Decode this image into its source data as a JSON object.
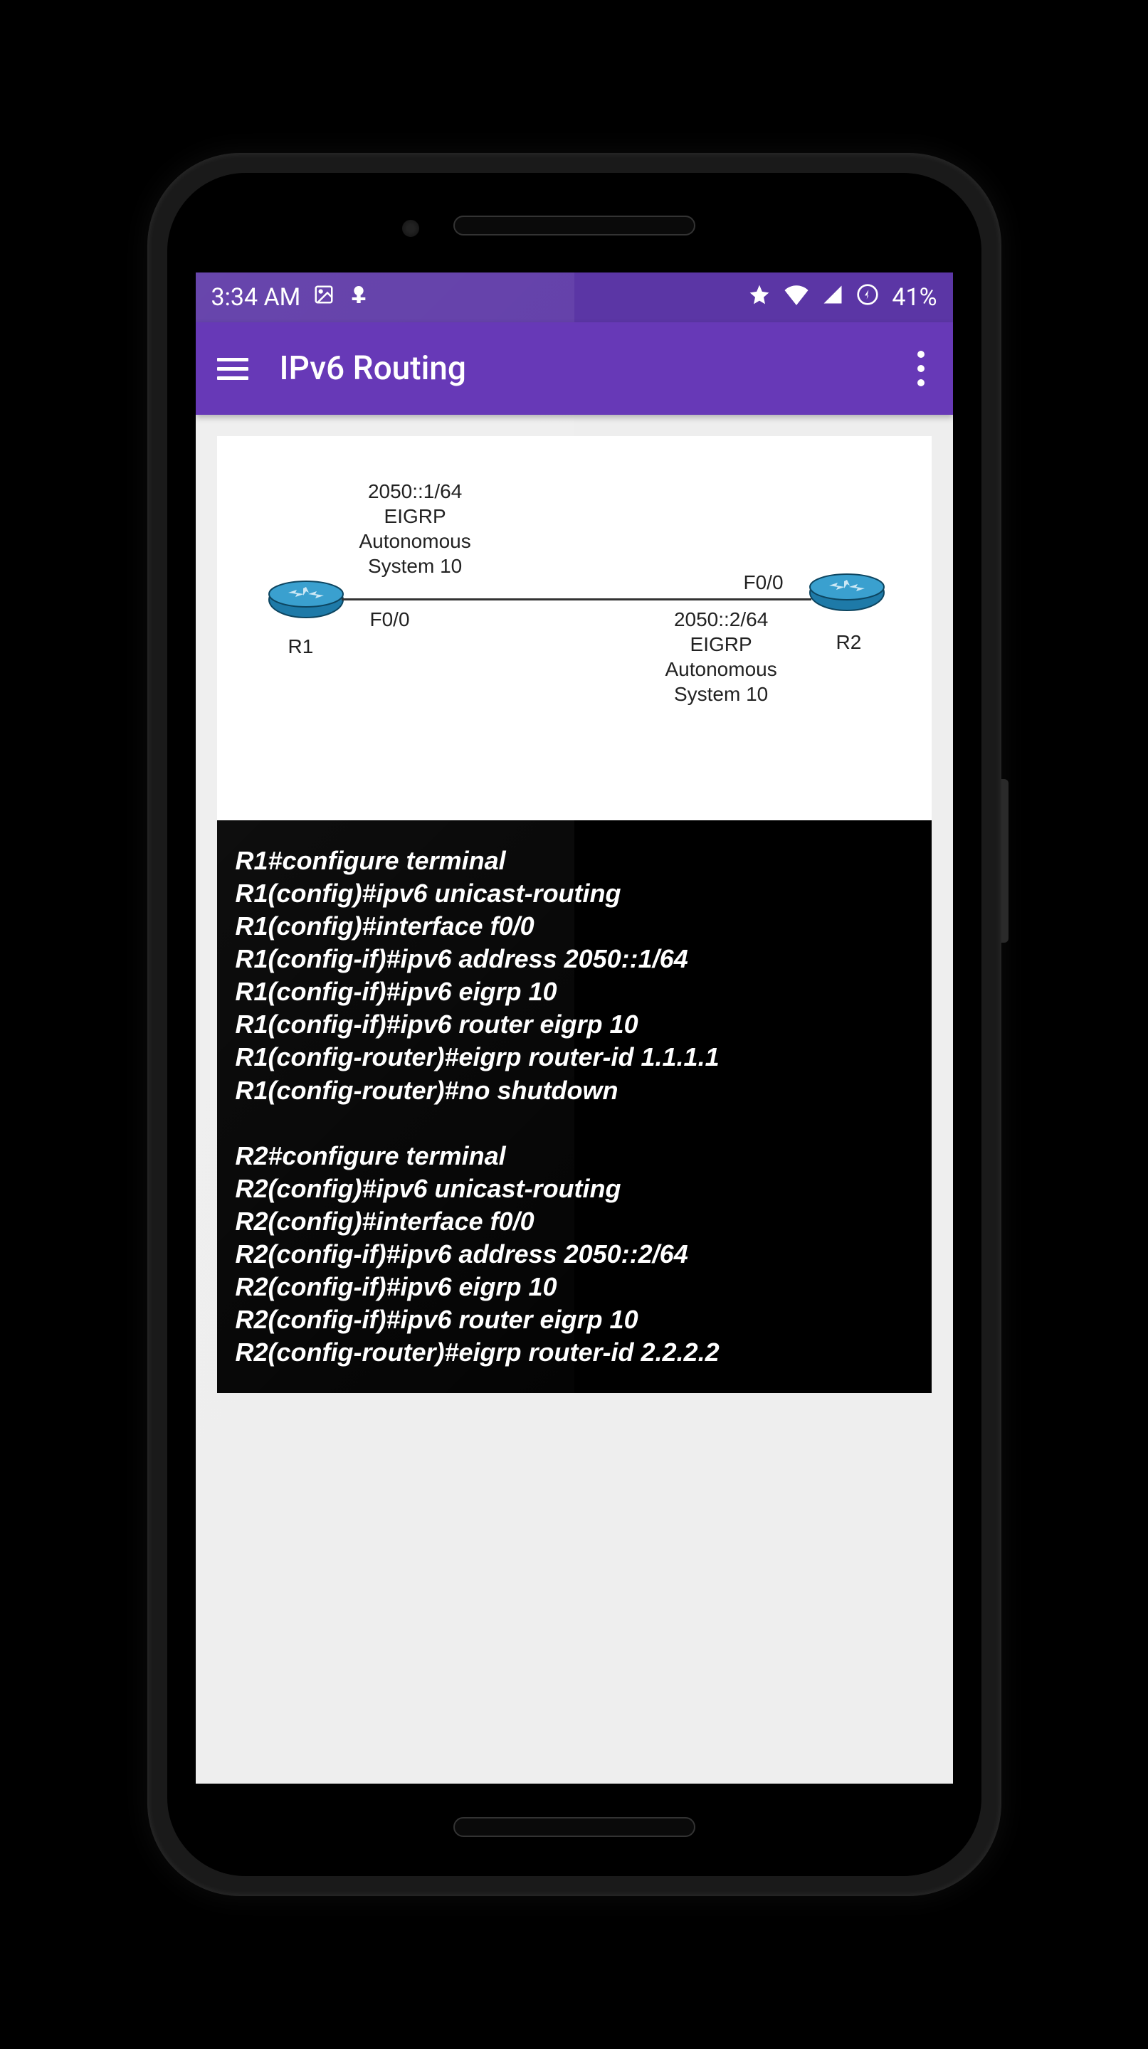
{
  "status_bar": {
    "time": "3:34 AM",
    "battery_percent": "41%",
    "icons_left": [
      "image-icon",
      "android-icon"
    ],
    "icons_right": [
      "star-icon",
      "wifi-icon",
      "cell-icon",
      "charge-circle-icon"
    ]
  },
  "app_bar": {
    "title": "IPv6 Routing"
  },
  "diagram": {
    "r1_label": "R1",
    "r2_label": "R2",
    "r1_iface": "F0/0",
    "r2_iface": "F0/0",
    "r1_block": "2050::1/64\nEIGRP\nAutonomous\nSystem 10",
    "r2_block": "2050::2/64\nEIGRP\nAutonomous\nSystem 10"
  },
  "terminal_lines": [
    "R1#configure terminal",
    "R1(config)#ipv6 unicast-routing",
    "R1(config)#interface f0/0",
    "R1(config-if)#ipv6 address 2050::1/64",
    "R1(config-if)#ipv6 eigrp 10",
    "R1(config-if)#ipv6 router eigrp 10",
    "R1(config-router)#eigrp router-id 1.1.1.1",
    "R1(config-router)#no shutdown",
    "",
    "R2#configure terminal",
    "R2(config)#ipv6 unicast-routing",
    "R2(config)#interface f0/0",
    "R2(config-if)#ipv6 address 2050::2/64",
    "R2(config-if)#ipv6 eigrp 10",
    "R2(config-if)#ipv6 router eigrp 10",
    "R2(config-router)#eigrp router-id 2.2.2.2"
  ]
}
